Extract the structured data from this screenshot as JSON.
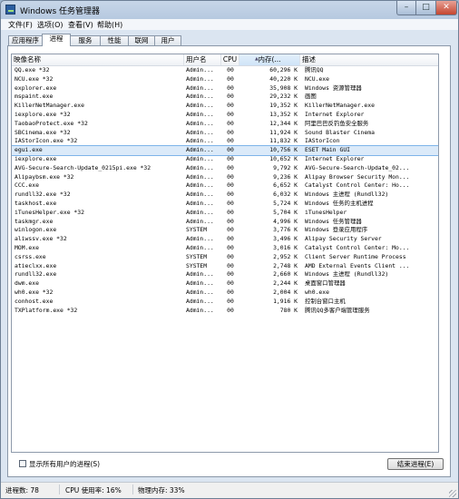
{
  "window": {
    "title": "Windows 任务管理器",
    "controls": {
      "minimize": "–",
      "maximize": "□",
      "close": "✕"
    }
  },
  "menu": [
    "文件(F)",
    "选项(O)",
    "查看(V)",
    "帮助(H)"
  ],
  "tabs": [
    "应用程序",
    "进程",
    "服务",
    "性能",
    "联网",
    "用户"
  ],
  "active_tab": "进程",
  "columns": {
    "name": "映像名称",
    "user": "用户名",
    "cpu": "CPU",
    "mem": "内存(...",
    "desc": "描述"
  },
  "processes": [
    {
      "name": "QQ.exe *32",
      "user": "Admin...",
      "cpu": "00",
      "mem": "60,296 K",
      "desc": "腾讯QQ"
    },
    {
      "name": "NCU.exe *32",
      "user": "Admin...",
      "cpu": "00",
      "mem": "40,220 K",
      "desc": "NCU.exe"
    },
    {
      "name": "explorer.exe",
      "user": "Admin...",
      "cpu": "00",
      "mem": "35,908 K",
      "desc": "Windows 资源管理器"
    },
    {
      "name": "mspaint.exe",
      "user": "Admin...",
      "cpu": "00",
      "mem": "29,232 K",
      "desc": "画图"
    },
    {
      "name": "KillerNetManager.exe",
      "user": "Admin...",
      "cpu": "00",
      "mem": "19,352 K",
      "desc": "KillerNetManager.exe"
    },
    {
      "name": "iexplore.exe *32",
      "user": "Admin...",
      "cpu": "00",
      "mem": "13,352 K",
      "desc": "Internet Explorer"
    },
    {
      "name": "TaobaoProtect.exe *32",
      "user": "Admin...",
      "cpu": "00",
      "mem": "12,344 K",
      "desc": "阿里巴巴反钓鱼安全服务"
    },
    {
      "name": "SBCinema.exe *32",
      "user": "Admin...",
      "cpu": "00",
      "mem": "11,924 K",
      "desc": "Sound Blaster Cinema"
    },
    {
      "name": "IAStorIcon.exe *32",
      "user": "Admin...",
      "cpu": "00",
      "mem": "11,832 K",
      "desc": "IAStorIcon"
    },
    {
      "name": "egui.exe",
      "user": "Admin...",
      "cpu": "00",
      "mem": "10,756 K",
      "desc": "ESET Main GUI"
    },
    {
      "name": "iexplore.exe",
      "user": "Admin...",
      "cpu": "00",
      "mem": "10,652 K",
      "desc": "Internet Explorer"
    },
    {
      "name": "AVG-Secure-Search-Update_0215pi.exe *32",
      "user": "Admin...",
      "cpu": "00",
      "mem": "9,792 K",
      "desc": "AVG-Secure-Search-Update_02..."
    },
    {
      "name": "Alipaybsm.exe *32",
      "user": "Admin...",
      "cpu": "00",
      "mem": "9,236 K",
      "desc": "Alipay Browser Security Mon..."
    },
    {
      "name": "CCC.exe",
      "user": "Admin...",
      "cpu": "00",
      "mem": "6,652 K",
      "desc": "Catalyst Control Center: Ho..."
    },
    {
      "name": "rundll32.exe *32",
      "user": "Admin...",
      "cpu": "00",
      "mem": "6,032 K",
      "desc": "Windows 主进程 (Rundll32)"
    },
    {
      "name": "taskhost.exe",
      "user": "Admin...",
      "cpu": "00",
      "mem": "5,724 K",
      "desc": "Windows 任务的主机进程"
    },
    {
      "name": "iTunesHelper.exe *32",
      "user": "Admin...",
      "cpu": "00",
      "mem": "5,704 K",
      "desc": "iTunesHelper"
    },
    {
      "name": "taskmgr.exe",
      "user": "Admin...",
      "cpu": "00",
      "mem": "4,996 K",
      "desc": "Windows 任务管理器"
    },
    {
      "name": "winlogon.exe",
      "user": "SYSTEM",
      "cpu": "00",
      "mem": "3,776 K",
      "desc": "Windows 登录应用程序"
    },
    {
      "name": "aliwssv.exe *32",
      "user": "Admin...",
      "cpu": "00",
      "mem": "3,496 K",
      "desc": "Alipay Security Server"
    },
    {
      "name": "MOM.exe",
      "user": "Admin...",
      "cpu": "00",
      "mem": "3,016 K",
      "desc": "Catalyst Control Center: Mo..."
    },
    {
      "name": "csrss.exe",
      "user": "SYSTEM",
      "cpu": "00",
      "mem": "2,952 K",
      "desc": "Client Server Runtime Process"
    },
    {
      "name": "atieclxx.exe",
      "user": "SYSTEM",
      "cpu": "00",
      "mem": "2,748 K",
      "desc": "AMD External Events Client ..."
    },
    {
      "name": "rundll32.exe",
      "user": "Admin...",
      "cpu": "00",
      "mem": "2,660 K",
      "desc": "Windows 主进程 (Rundll32)"
    },
    {
      "name": "dwm.exe",
      "user": "Admin...",
      "cpu": "00",
      "mem": "2,244 K",
      "desc": "桌面窗口管理器"
    },
    {
      "name": "wh0.exe *32",
      "user": "Admin...",
      "cpu": "00",
      "mem": "2,004 K",
      "desc": "wh0.exe"
    },
    {
      "name": "conhost.exe",
      "user": "Admin...",
      "cpu": "00",
      "mem": "1,916 K",
      "desc": "控制台窗口主机"
    },
    {
      "name": "TXPlatform.exe *32",
      "user": "Admin...",
      "cpu": "00",
      "mem": "780 K",
      "desc": "腾讯QQ多客户端管理服务"
    }
  ],
  "selected_process": "egui.exe",
  "show_all_label": "显示所有用户的进程(S)",
  "end_button": "结束进程(E)",
  "status": {
    "processes": "进程数: 78",
    "cpu": "CPU 使用率: 16%",
    "memory": "物理内存: 33%"
  },
  "colors": {
    "selection": "#dbeaf9",
    "selection_border": "#7eb4ea",
    "close_button": "#c4452f",
    "title_bar": "#b6c9e0"
  }
}
